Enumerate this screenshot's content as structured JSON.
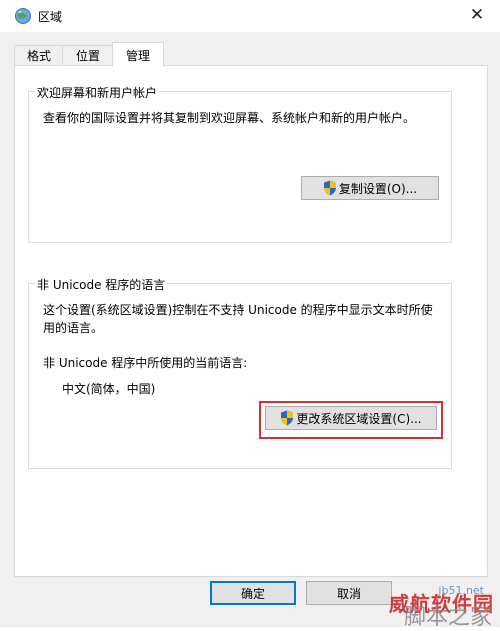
{
  "window": {
    "title": "区域",
    "close_glyph": "✕"
  },
  "tabs": [
    {
      "label": "格式"
    },
    {
      "label": "位置"
    },
    {
      "label": "管理"
    }
  ],
  "welcome": {
    "legend": "欢迎屏幕和新用户帐户",
    "description": "查看你的国际设置并将其复制到欢迎屏幕、系统帐户和新的用户帐户。",
    "copy_button": "复制设置(O)..."
  },
  "non_unicode": {
    "legend": "非 Unicode 程序的语言",
    "description_line1": "这个设置(系统区域设置)控制在不支持 Unicode 的程序中显示文本时所使",
    "description_line2": "用的语言。",
    "current_label": "非 Unicode 程序中所使用的当前语言:",
    "current_value": "中文(简体，中国)",
    "change_button": "更改系统区域设置(C)..."
  },
  "footer": {
    "ok_button": "确定",
    "cancel_button": "取消"
  },
  "watermark": {
    "line1": "威航软件园",
    "line2": "脚本之家",
    "line3": "jb51.net"
  },
  "colors": {
    "highlight": "#d9302c",
    "shield_blue": "#2b66c8",
    "shield_yellow": "#f2c21b"
  }
}
